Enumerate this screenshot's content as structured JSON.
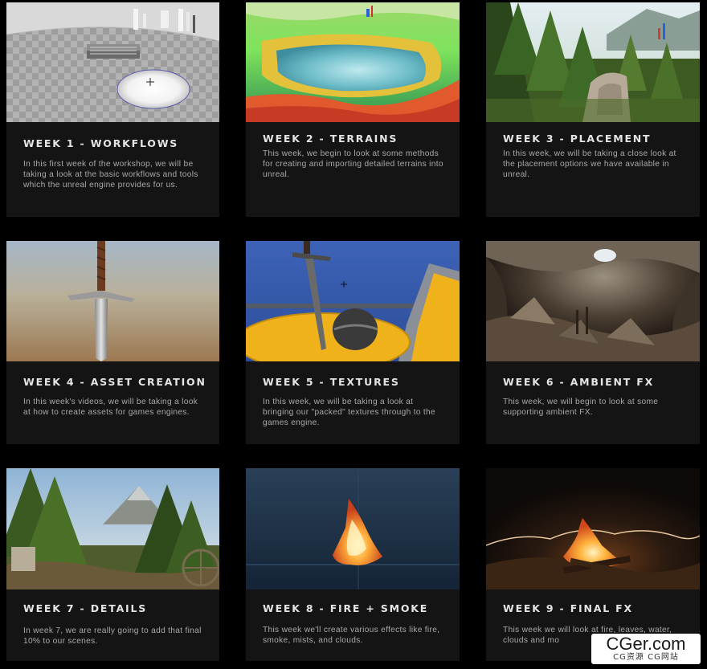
{
  "cards": [
    {
      "title": "WEEK 1 - WORKFLOWS",
      "description": "In this first week of the workshop, we will be taking a look at the basic workflows and tools which the unreal engine provides for us."
    },
    {
      "title": "WEEK 2 - TERRAINS",
      "description": "This week, we begin to look at some methods for creating and importing detailed terrains into unreal."
    },
    {
      "title": "WEEK 3 - PLACEMENT",
      "description": "In this week, we will be taking a close look at the placement options we have available in unreal."
    },
    {
      "title": "WEEK 4 - ASSET CREATION",
      "description": "In this week's videos, we will be taking a look at how to create assets for games engines."
    },
    {
      "title": "WEEK 5 - TEXTURES",
      "description": "In this week, we will be taking a look at bringing our \"packed\" textures through to the games engine."
    },
    {
      "title": "WEEK 6 - AMBIENT FX",
      "description": "This week, we will begin to look at some supporting ambient FX."
    },
    {
      "title": "WEEK 7 - DETAILS",
      "description": "In week 7, we are really going to add that final 10% to our scenes."
    },
    {
      "title": "WEEK 8 - FIRE + SMOKE",
      "description": "This week we'll create various effects like fire, smoke, mists, and clouds."
    },
    {
      "title": "WEEK 9 - FINAL FX",
      "description": "This week we will look at fire, leaves, water, clouds and mo"
    }
  ],
  "watermark": {
    "main": "CGer.com",
    "sub": "CG资源 CG网站"
  }
}
